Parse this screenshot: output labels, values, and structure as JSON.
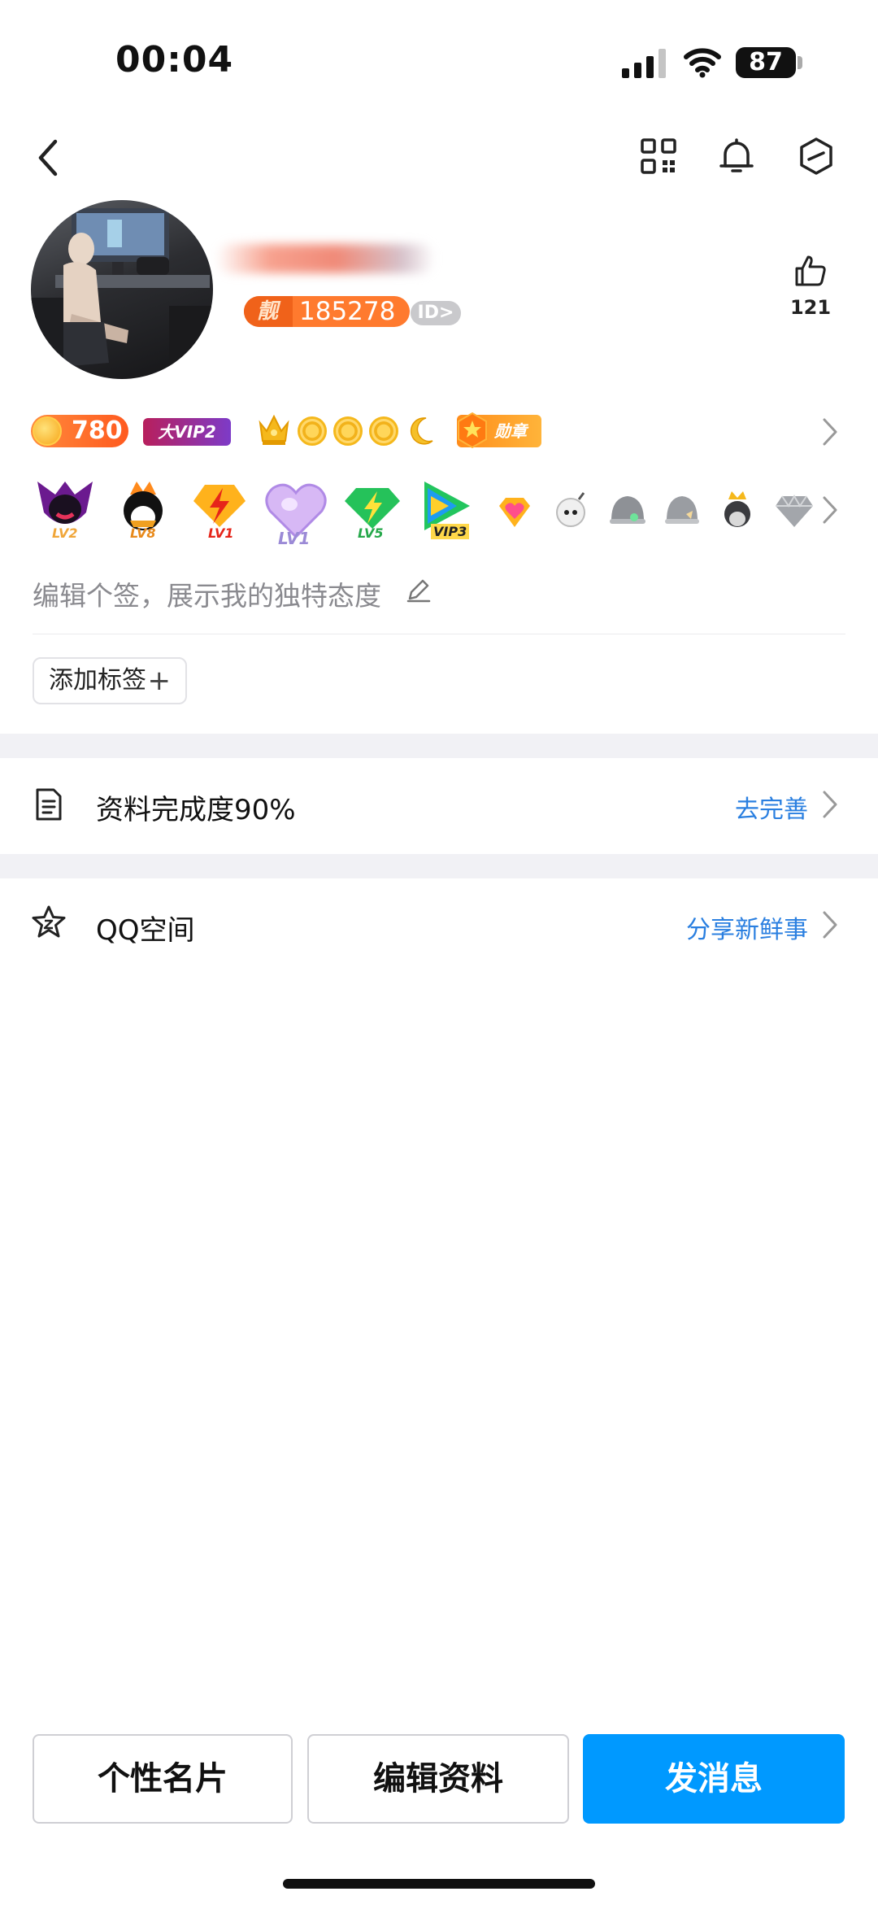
{
  "status_bar": {
    "time": "00:04",
    "battery": "87"
  },
  "nav": {
    "icons": [
      "back-icon",
      "qrcode-icon",
      "bell-icon",
      "hexagon-settings-icon"
    ]
  },
  "profile": {
    "pretty_number_tag": "靓",
    "pretty_number": "185278",
    "id_badge": "ID>",
    "likes": "121"
  },
  "badges_row1": {
    "coins": "780",
    "vip": "大VIP2",
    "medal": "勋章"
  },
  "badges_row2": {
    "items": [
      {
        "icon": "lv2-devil-icon",
        "label": "LV2"
      },
      {
        "icon": "lv8-qq-icon",
        "label": "LV8"
      },
      {
        "icon": "lv1-lightning-icon",
        "label": "LV1"
      },
      {
        "icon": "lv1-heart-icon",
        "label": "LV1"
      },
      {
        "icon": "lv5-diamond-icon",
        "label": "LV5"
      },
      {
        "icon": "vip3-video-icon",
        "label": "VIP3"
      },
      {
        "icon": "heart-gem-icon",
        "label": ""
      },
      {
        "icon": "bomb-icon",
        "label": ""
      },
      {
        "icon": "gray-helmet-icon",
        "label": ""
      },
      {
        "icon": "gray-penguin-icon",
        "label": ""
      },
      {
        "icon": "crown-penguin-icon",
        "label": ""
      },
      {
        "icon": "gray-diamond-icon",
        "label": ""
      }
    ]
  },
  "signature": "编辑个签，展示我的独特态度",
  "tag_button": "添加标签",
  "profile_completion": {
    "title": "资料完成度90%",
    "action": "去完善"
  },
  "qzone": {
    "title": "QQ空间",
    "action": "分享新鲜事"
  },
  "bottom_buttons": {
    "card": "个性名片",
    "edit": "编辑资料",
    "message": "发消息"
  },
  "colors": {
    "accent_blue": "#0099ff",
    "link_blue": "#2a7fe0",
    "section_gray": "#f1f1f5"
  }
}
